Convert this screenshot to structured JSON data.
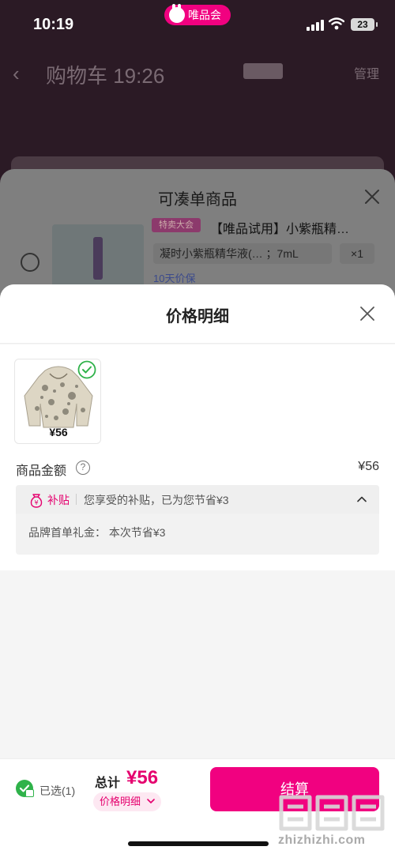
{
  "status_bar": {
    "time": "10:19",
    "app_badge": "唯品会",
    "battery": "23"
  },
  "cart_page": {
    "title": "购物车 19:26",
    "subtitle": "",
    "edit_label": "管理"
  },
  "add_on_sheet": {
    "title": "可凑单商品",
    "badge": "特卖大会",
    "product_name": "【唯品试用】小紫瓶精…",
    "spec": "凝时小紫瓶精华液(… ；7mL",
    "qty": "×1",
    "guarantee": "10天价保"
  },
  "price_sheet": {
    "title": "价格明细",
    "product_price": "¥56",
    "amount_label": "商品金额",
    "help_symbol": "?",
    "amount_value": "¥56",
    "subsidy_tag": "补贴",
    "subsidy_desc": "您享受的补贴，已为您节省¥3",
    "subsidy_line": "品牌首单礼金：  本次节省¥3"
  },
  "bottom_bar": {
    "selected_text": "已选(1)",
    "total_label": "总计",
    "total_value": "¥56",
    "price_detail_label": "价格明细",
    "checkout_label": "结算",
    "watermark_text": "zhizhizhi.com"
  },
  "colors": {
    "brand": "#f10180",
    "accent_text": "#e5006e",
    "success": "#2fb24a"
  },
  "icons": [
    "back-arrow-icon",
    "close-icon",
    "help-icon",
    "subsidy-coin-icon",
    "chevron-up-icon",
    "chevron-down-icon",
    "check-icon",
    "lock-icon"
  ]
}
